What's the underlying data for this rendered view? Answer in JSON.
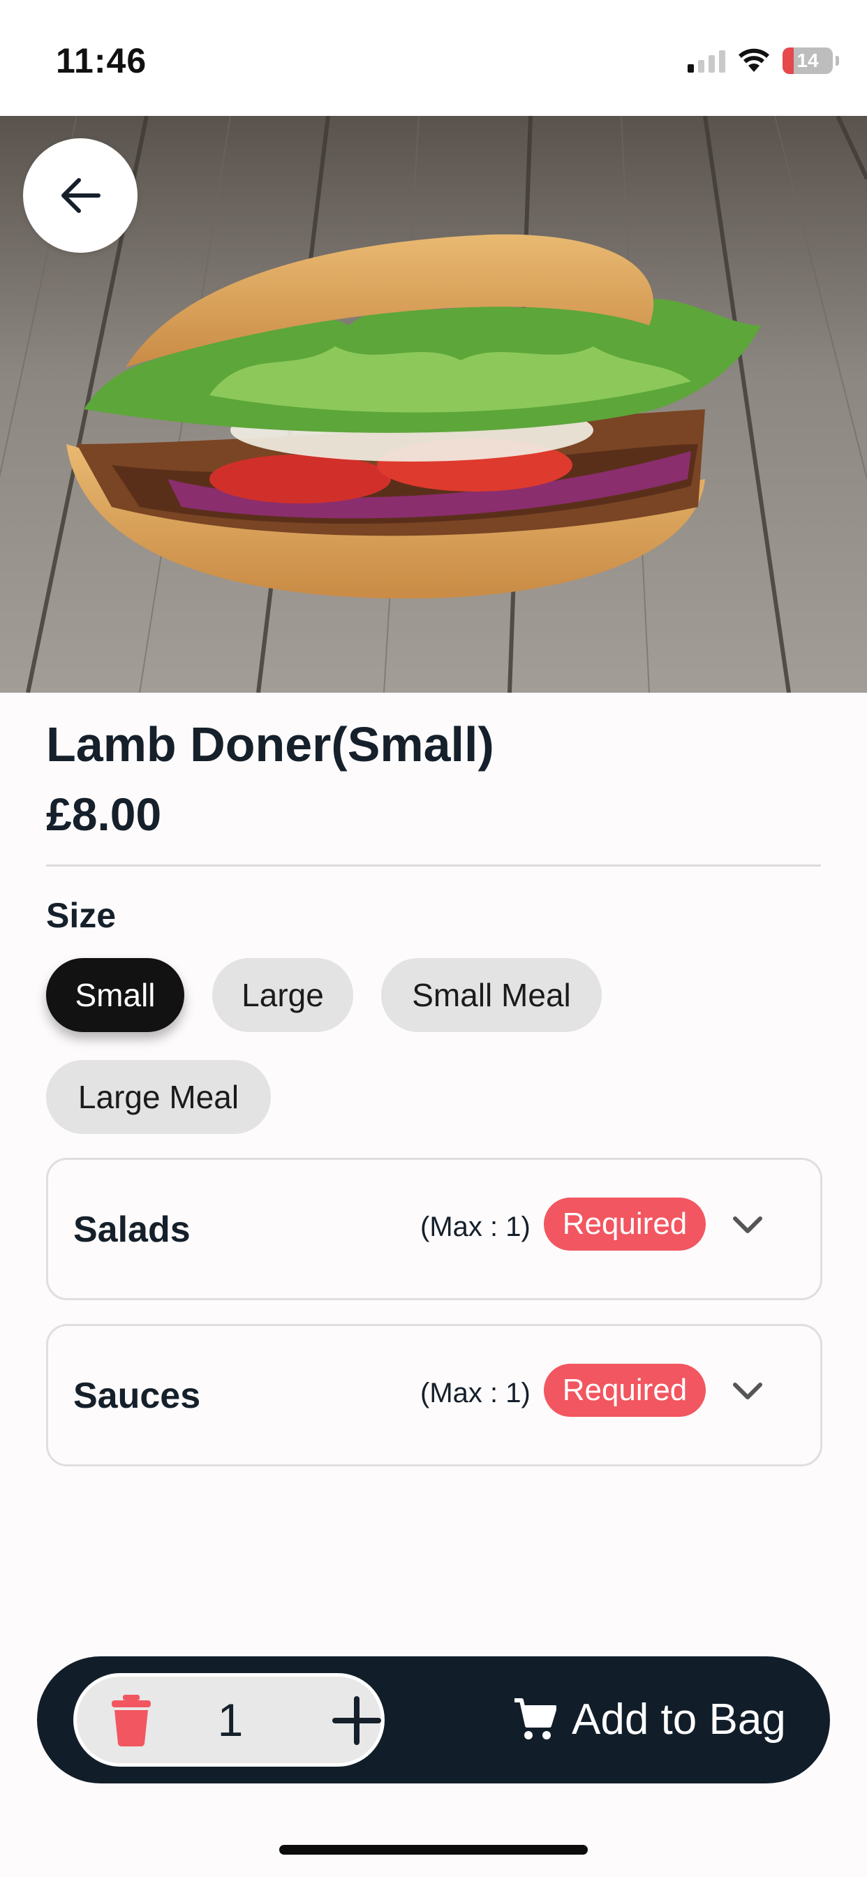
{
  "status_bar": {
    "time": "11:46",
    "battery": "14",
    "battery_color": "#e5484d"
  },
  "hero": {
    "image": "doner-kebab-photo",
    "back_icon": "arrow-left-icon"
  },
  "product": {
    "title": "Lamb Doner(Small)",
    "price": "£8.00"
  },
  "size": {
    "label": "Size",
    "options": [
      "Small",
      "Large",
      "Small Meal",
      "Large Meal"
    ],
    "selected": "Small"
  },
  "option_groups": [
    {
      "title": "Salads",
      "max": "(Max : 1)",
      "badge": "Required",
      "icon": "chevron-down-icon"
    },
    {
      "title": "Sauces",
      "max": "(Max : 1)",
      "badge": "Required",
      "icon": "chevron-down-icon"
    }
  ],
  "cart": {
    "quantity": "1",
    "remove_icon": "trash-icon",
    "add_icon": "plus-icon",
    "cart_icon": "cart-icon",
    "add_label": "Add to Bag"
  },
  "colors": {
    "accent_dark": "#111e2a",
    "required": "#f25660",
    "trash": "#f25660",
    "chip_selected": "#121212",
    "chip": "#e3e3e3"
  }
}
